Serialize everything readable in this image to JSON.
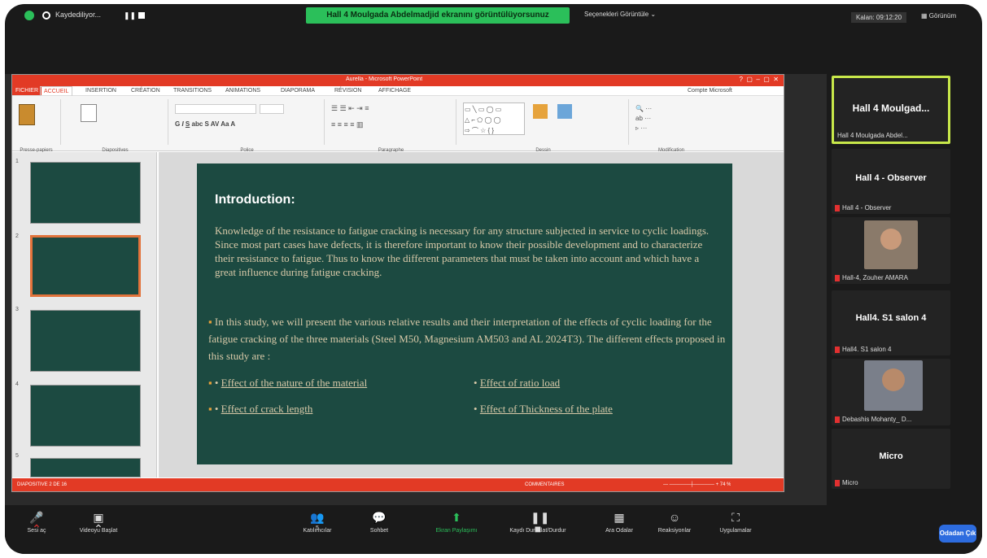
{
  "topbar": {
    "recording_label": "Kaydediliyor...",
    "banner": "Hall 4 Moulgada Abdelmadjid ekranını görüntülüyorsunuz",
    "view_options": "Seçenekleri Görüntüle",
    "timer": "Kalan: 09:12:20",
    "view_mode": "Görünüm"
  },
  "ppt": {
    "window_title": "Aurella - Microsoft PowerPoint",
    "tabs": [
      "FICHIER",
      "ACCUEIL",
      "INSERTION",
      "CRÉATION",
      "TRANSITIONS",
      "ANIMATIONS",
      "DIAPORAMA",
      "RÉVISION",
      "AFFICHAGE"
    ],
    "account": "Compte Microsoft",
    "ribbon_groups": [
      "Presse-papiers",
      "Diapositives",
      "Police",
      "Paragraphe",
      "Dessin",
      "Modification"
    ],
    "status_left": "DIAPOSITIVE 2 DE 16",
    "status_comments": "COMMENTAIRES",
    "zoom": "74 %"
  },
  "slide": {
    "heading": "Introduction:",
    "paragraph": "Knowledge of the resistance to fatigue cracking is necessary for any structure subjected in service to cyclic loadings. Since most part cases have defects, it is therefore important to know their possible development and to characterize their resistance to fatigue. Thus to know the different parameters that must be taken into account and which have a great influence during fatigue cracking.",
    "bullet": "In this study, we will present the various relative results and their interpretation of the effects of cyclic loading for the fatigue cracking of the three materials (Steel M50, Magnesium AM503 and AL 2024T3). The different effects proposed in this study are :",
    "effects": [
      "Effect of the nature of the material",
      "Effect of ratio load",
      "Effect of crack length",
      "Effect of Thickness of the plate"
    ]
  },
  "participants": [
    {
      "name": "Hall 4 Moulgad...",
      "label": "Hall 4 Moulgada Abdel...",
      "active": true
    },
    {
      "name": "Hall 4 - Observer",
      "label": "Hall 4 - Observer"
    },
    {
      "name": "",
      "label": "Hall-4, Zouher AMARA"
    },
    {
      "name": "Hall4. S1 salon 4",
      "label": "Hall4. S1 salon 4"
    },
    {
      "name": "",
      "label": "Debashis Mohanty_ D..."
    },
    {
      "name": "Micro",
      "label": "Micro"
    }
  ],
  "toolbar": {
    "mute": "Sesi aç",
    "video": "Videoyu Başlat",
    "participants": "Katılımcılar",
    "participants_count": "5",
    "chat": "Sohbet",
    "share": "Ekran Paylaşımı",
    "record": "Kaydı Duraklat/Durdur",
    "breakout": "Ara Odalar",
    "reactions": "Reaksiyonlar",
    "apps": "Uygulamalar",
    "leave": "Odadan Çık"
  },
  "colors": {
    "accent_green": "#2bbf5a",
    "ppt_red": "#e23a25",
    "slide_bg": "#1c4a41",
    "active_border": "#c8e84a",
    "leave_blue": "#2d6cdf"
  }
}
